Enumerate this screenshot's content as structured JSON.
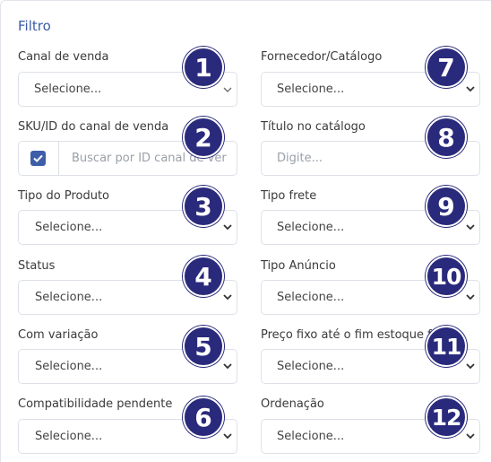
{
  "filter_title": "Filtro",
  "left_column": [
    {
      "label": "Canal de venda",
      "type": "select",
      "value": "Selecione...",
      "number": "1"
    },
    {
      "label": "SKU/ID do canal de venda",
      "type": "checkbox-input",
      "placeholder": "Buscar por ID canal de ver",
      "checked": true,
      "number": "2"
    },
    {
      "label": "Tipo do Produto",
      "type": "select",
      "value": "Selecione...",
      "number": "3"
    },
    {
      "label": "Status",
      "type": "select",
      "value": "Selecione...",
      "number": "4"
    },
    {
      "label": "Com variação",
      "type": "select",
      "value": "Selecione...",
      "number": "5"
    },
    {
      "label": "Compatibilidade pendente",
      "type": "select",
      "value": "Selecione...",
      "number": "6"
    }
  ],
  "right_column": [
    {
      "label": "Fornecedor/Catálogo",
      "type": "select",
      "value": "Selecione...",
      "number": "7"
    },
    {
      "label": "Título no catálogo",
      "type": "input",
      "placeholder": "Digite...",
      "number": "8"
    },
    {
      "label": "Tipo frete",
      "type": "select",
      "value": "Selecione...",
      "number": "9"
    },
    {
      "label": "Tipo Anúncio",
      "type": "select",
      "value": "Selecione...",
      "number": "10"
    },
    {
      "label": "Preço fixo até o fim estoque f",
      "type": "select",
      "value": "Selecione...",
      "number": "11"
    },
    {
      "label": "Ordenação",
      "type": "select",
      "value": "Selecione...",
      "number": "12"
    }
  ],
  "colors": {
    "accent": "#3b5ba7",
    "badge": "#2a2a7c",
    "checkbox": "#3f5ea8",
    "border": "#dde1e7"
  },
  "icons": {
    "chevron": "chevron-down-icon",
    "check": "check-icon"
  }
}
